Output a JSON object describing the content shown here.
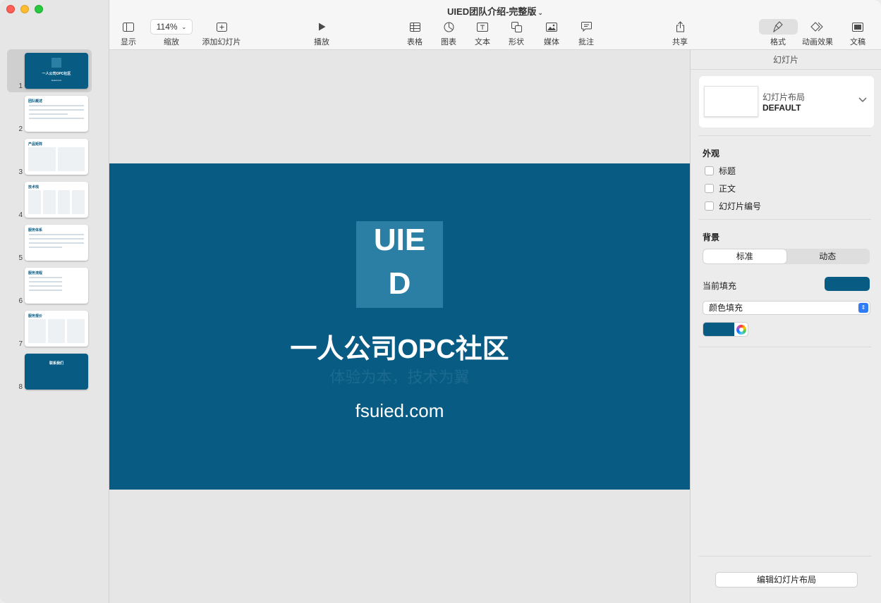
{
  "window": {
    "title": "UIED团队介绍-完整版",
    "title_chevron": "⌄"
  },
  "toolbar": {
    "view_label": "显示",
    "zoom_value": "114%",
    "zoom_label": "缩放",
    "add_slide_label": "添加幻灯片",
    "play_label": "播放",
    "table_label": "表格",
    "chart_label": "图表",
    "text_label": "文本",
    "shape_label": "形状",
    "media_label": "媒体",
    "comment_label": "批注",
    "share_label": "共享",
    "format_label": "格式",
    "animate_label": "动画效果",
    "document_label": "文稿"
  },
  "navigator": {
    "slides": [
      {
        "number": "1",
        "title": "一人公司OPC社区",
        "style": "dark",
        "selected": true
      },
      {
        "number": "2",
        "title": "团队概述",
        "style": "light"
      },
      {
        "number": "3",
        "title": "产品矩阵",
        "style": "light"
      },
      {
        "number": "4",
        "title": "技术栈",
        "style": "light"
      },
      {
        "number": "5",
        "title": "服务体系",
        "style": "light"
      },
      {
        "number": "6",
        "title": "服务流程",
        "style": "light"
      },
      {
        "number": "7",
        "title": "服务报价",
        "style": "light"
      },
      {
        "number": "8",
        "title": "联系我们",
        "style": "dark"
      }
    ],
    "first_thumb_logo": "UIE D",
    "first_thumb_url": "fsuied.com"
  },
  "slide": {
    "logo_line1": "UIE",
    "logo_line2": "D",
    "title": "一人公司OPC社区",
    "subtitle": "体验为本，技术为翼",
    "url": "fsuied.com",
    "background_color": "#085b82",
    "logo_box_color": "#2b7ea4"
  },
  "inspector": {
    "header": "幻灯片",
    "layout_label": "幻灯片布局",
    "layout_value": "DEFAULT",
    "appearance_title": "外观",
    "checkbox_title": "标题",
    "checkbox_body": "正文",
    "checkbox_slide_number": "幻灯片编号",
    "background_title": "背景",
    "seg_standard": "标准",
    "seg_dynamic": "动态",
    "current_fill_label": "当前填充",
    "fill_type": "颜色填充",
    "fill_color": "#085b82",
    "edit_layout_button": "编辑幻灯片布局"
  }
}
